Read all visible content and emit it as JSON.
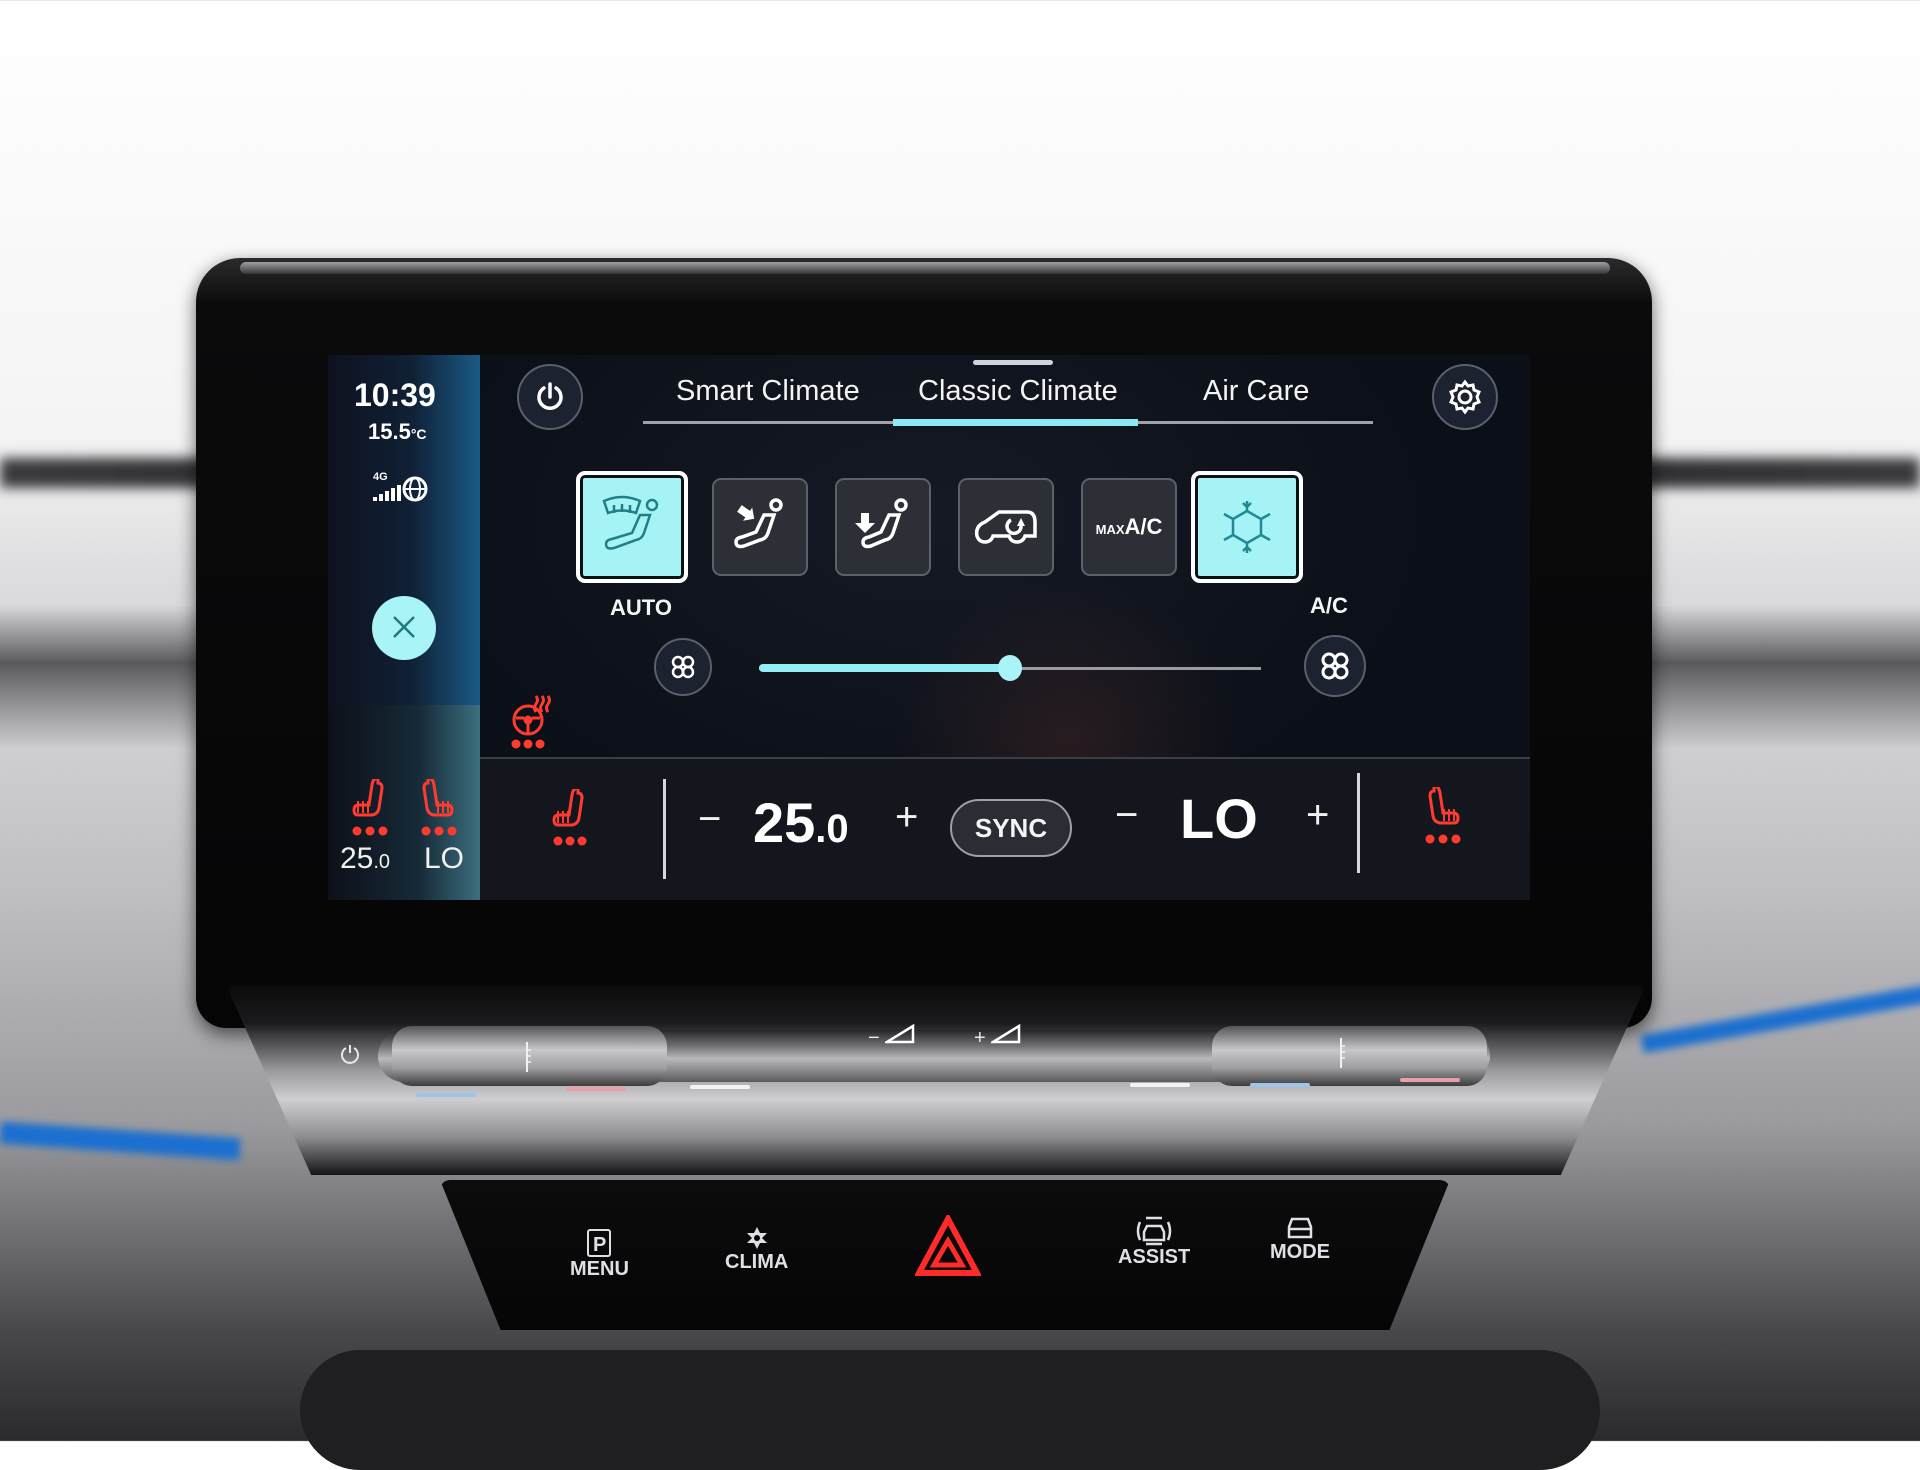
{
  "status": {
    "time": "10:39",
    "outside_temp_value": "15.5",
    "outside_temp_unit": "°C",
    "network": "4G",
    "signal_bars": 5
  },
  "tabs": [
    {
      "label": "Smart Climate",
      "active": false
    },
    {
      "label": "Classic Climate",
      "active": true
    },
    {
      "label": "Air Care",
      "active": false
    }
  ],
  "tiles": [
    {
      "name": "auto-fan",
      "label": "AUTO",
      "active": false
    },
    {
      "name": "windscreen-defrost",
      "label": "",
      "active": true
    },
    {
      "name": "airflow-upper-body",
      "label": "",
      "active": false
    },
    {
      "name": "airflow-footwell",
      "label": "",
      "active": false
    },
    {
      "name": "recirculation",
      "label": "",
      "active": false
    },
    {
      "name": "max-ac",
      "label": "",
      "glyph_small": "MAX",
      "glyph_big": "A/C",
      "active": false
    },
    {
      "name": "ac",
      "label": "A/C",
      "active": true
    }
  ],
  "fan_speed": {
    "fraction": 0.5
  },
  "left_mini": {
    "driver_temp_int": "25",
    "driver_temp_dec": ".0",
    "passenger_temp": "LO",
    "driver_seat_heat_level": 3,
    "passenger_seat_heat_level": 3
  },
  "steering_heat_level": 3,
  "bottom": {
    "minus": "−",
    "plus": "+",
    "driver_temp_int": "25",
    "driver_temp_dec": ".0",
    "sync_label": "SYNC",
    "passenger_temp": "LO",
    "driver_seat_heat_level": 3,
    "passenger_seat_heat_level": 3
  },
  "colors": {
    "accent_cyan": "#a6f3f6",
    "heat_red": "#ff3b30",
    "screen_bg": "#0b0f17"
  },
  "physical_buttons": [
    {
      "label": "MENU",
      "icon": "parking-p-icon"
    },
    {
      "label": "CLIMA",
      "icon": "clima-icon"
    },
    {
      "label": "",
      "icon": "hazard-icon"
    },
    {
      "label": "ASSIST",
      "icon": "assist-icon"
    },
    {
      "label": "MODE",
      "icon": "mode-car-icon"
    }
  ],
  "physical_slider": {
    "vol_minus": "−",
    "vol_plus": "+"
  }
}
